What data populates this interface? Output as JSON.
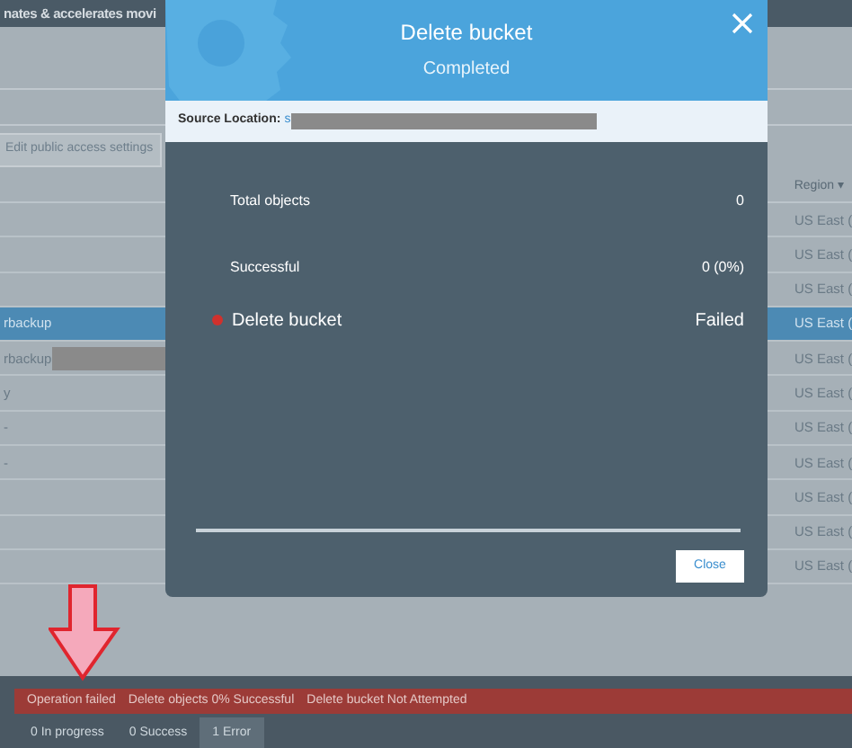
{
  "page": {
    "banner_text": "nates & accelerates movi",
    "toolbar_button": "Edit public access settings",
    "region_header": "Region",
    "sort_caret": "▾",
    "rows": [
      {
        "region": "US East (",
        "selected": false
      },
      {
        "region": "US East (",
        "selected": false
      },
      {
        "region": "US East (",
        "selected": false
      },
      {
        "name": "rbackup",
        "region": "US East (",
        "selected": true
      },
      {
        "name": "rbackup",
        "redacted": true,
        "region": "US East (",
        "selected": false
      },
      {
        "name": "y",
        "region": "US East (",
        "selected": false
      },
      {
        "name": "-",
        "region": "US East (",
        "selected": false
      },
      {
        "name": "-",
        "region": "US East (",
        "selected": false
      },
      {
        "region": "US East (",
        "selected": false
      },
      {
        "region": "US East (",
        "selected": false
      },
      {
        "region": "US East (",
        "selected": false
      }
    ]
  },
  "modal": {
    "title": "Delete bucket",
    "subtitle": "Completed",
    "source_label": "Source Location:",
    "source_value": "s",
    "source_redacted": true,
    "stats": [
      {
        "kind": "stat",
        "label": "Total objects",
        "value": "0"
      },
      {
        "kind": "stat",
        "label": "Successful",
        "value": "0 (0%)"
      },
      {
        "kind": "task",
        "label": "Delete bucket",
        "value": "Failed",
        "failed": true
      }
    ],
    "close_button": "Close"
  },
  "status_bar": {
    "messages": [
      "Operation failed",
      "Delete objects 0% Successful",
      "Delete bucket Not Attempted"
    ],
    "tabs": [
      {
        "label": "0 In progress",
        "selected": false
      },
      {
        "label": "0 Success",
        "selected": false
      },
      {
        "label": "1 Error",
        "selected": true
      }
    ]
  }
}
